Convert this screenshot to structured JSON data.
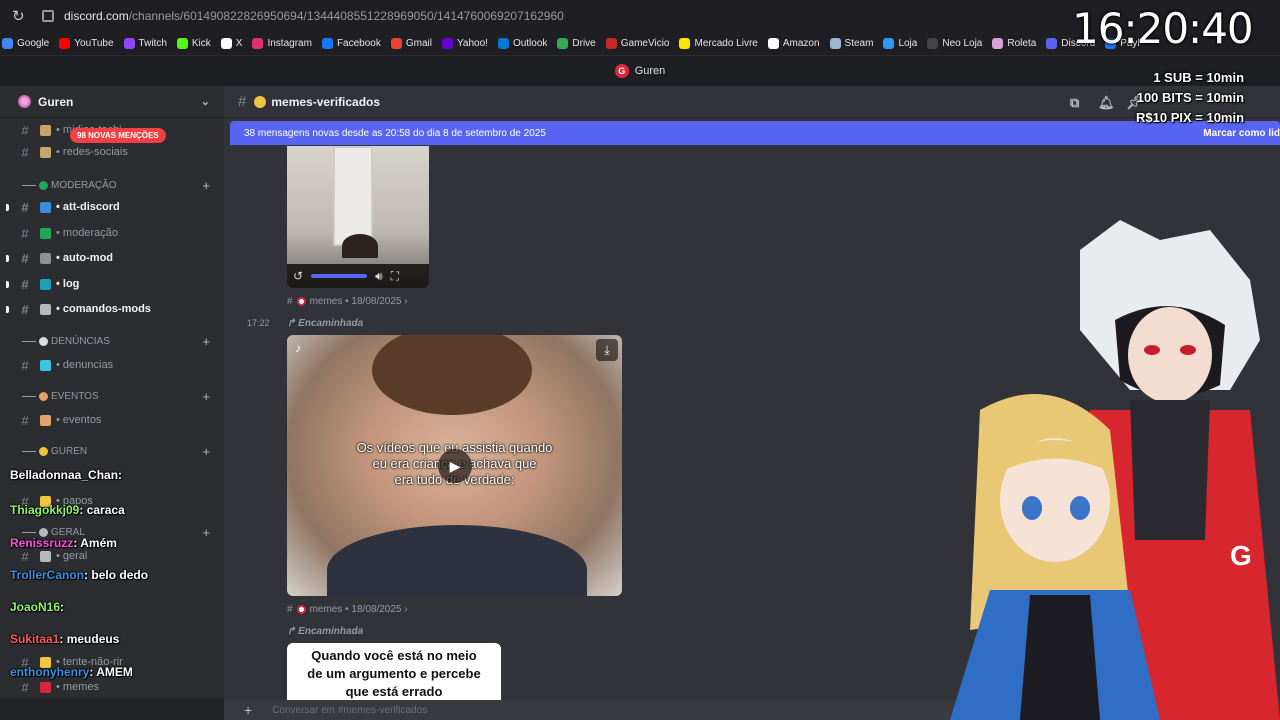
{
  "browser": {
    "url_main": "discord.com",
    "url_path": "/channels/601490822826950694/1344408551228969050/1414760069207162960",
    "bookmarks": [
      {
        "label": "Google",
        "color": "#4285f4"
      },
      {
        "label": "YouTube",
        "color": "#ff0000"
      },
      {
        "label": "Twitch",
        "color": "#9146ff"
      },
      {
        "label": "Kick",
        "color": "#53fc18"
      },
      {
        "label": "X",
        "color": "#ffffff"
      },
      {
        "label": "Instagram",
        "color": "#e1306c"
      },
      {
        "label": "Facebook",
        "color": "#1877f2"
      },
      {
        "label": "Gmail",
        "color": "#ea4335"
      },
      {
        "label": "Yahoo!",
        "color": "#6001d2"
      },
      {
        "label": "Outlook",
        "color": "#0078d4"
      },
      {
        "label": "Drive",
        "color": "#34a853"
      },
      {
        "label": "GameVicio",
        "color": "#c62828"
      },
      {
        "label": "Mercado Livre",
        "color": "#ffe600"
      },
      {
        "label": "Amazon",
        "color": "#ffffff"
      },
      {
        "label": "Steam",
        "color": "#9bb8d3"
      },
      {
        "label": "Loja",
        "color": "#2b9af3"
      },
      {
        "label": "Neo Loja",
        "color": "#444444"
      },
      {
        "label": "Roleta",
        "color": "#d6a0d9"
      },
      {
        "label": "Discord",
        "color": "#5865f2"
      },
      {
        "label": "Payl",
        "color": "#1877f2"
      }
    ]
  },
  "app_title": "Guren",
  "server": {
    "name": "Guren",
    "mention_pill": "98 NOVAS MENÇÕES"
  },
  "sidebar": {
    "channels": [
      {
        "label": "midias-tochi",
        "type": "ch",
        "unread": false,
        "emoji_color": "#c7a56a"
      },
      {
        "label": "redes-sociais",
        "type": "ch",
        "unread": false,
        "emoji_color": "#c7a56a"
      },
      {
        "label": "MODERAÇÃO",
        "type": "cat",
        "emoji_color": "#23a55a"
      },
      {
        "label": "att-discord",
        "type": "ch",
        "unread": true,
        "emoji_color": "#3b8ede"
      },
      {
        "label": "moderação",
        "type": "ch",
        "unread": false,
        "emoji_color": "#23a55a"
      },
      {
        "label": "auto-mod",
        "type": "ch",
        "unread": true,
        "emoji_color": "#8e9297"
      },
      {
        "label": "log",
        "type": "ch",
        "unread": true,
        "emoji_color": "#1a9fb5"
      },
      {
        "label": "comandos-mods",
        "type": "ch",
        "unread": true,
        "emoji_color": "#b5bac1"
      },
      {
        "label": "DENÚNCIAS",
        "type": "cat",
        "emoji_color": "#dcdcdc"
      },
      {
        "label": "denuncias",
        "type": "ch",
        "unread": false,
        "emoji_color": "#3fc4e0"
      },
      {
        "label": "EVENTOS",
        "type": "cat",
        "emoji_color": "#e0a36c"
      },
      {
        "label": "eventos",
        "type": "ch",
        "unread": false,
        "emoji_color": "#e0a36c"
      },
      {
        "label": "GUREN",
        "type": "cat",
        "emoji_color": "#f0c541"
      },
      {
        "label": "papos",
        "type": "ch",
        "unread": false,
        "emoji_color": "#f0c541"
      },
      {
        "label": "GERAL",
        "type": "cat",
        "emoji_color": "#b5bac1"
      },
      {
        "label": "geral",
        "type": "ch",
        "unread": false,
        "emoji_color": "#b5bac1"
      },
      {
        "label": "tente-não-rir",
        "type": "ch",
        "unread": false,
        "emoji_color": "#f0c541"
      },
      {
        "label": "memes",
        "type": "ch",
        "unread": false,
        "emoji_color": "#d7263d"
      }
    ]
  },
  "channel_header": {
    "name": "memes-verificados"
  },
  "main": {
    "new_messages": "38 mensagens novas desde as 20:58 do dia 8 de setembro de 2025",
    "mark_read": "Marcar como lid",
    "meta_source": "memes",
    "meta_date": "18/08/2025",
    "forwarded": "Encaminhada",
    "timestamp": "17:22",
    "video_caption_l1": "Os vídeos que eu assistia quando",
    "video_caption_l2": "eu era criança e achava que",
    "video_caption_l3": "era tudo de verdade:",
    "meme_text_l1": "Quando você está no meio",
    "meme_text_l2": "de um argumento e percebe",
    "meme_text_l3": "que está errado",
    "composer_placeholder": "Conversar em #memes-verificados"
  },
  "overlay": {
    "clock": "16:20:40",
    "donate_l1": "1 SUB = 10min",
    "donate_l2": "100 BITS = 10min",
    "donate_l3": "R$10 PIX = 10min",
    "chat": [
      {
        "user": "Belladonnaa_Chan",
        "msg": "",
        "color": "#ffffff"
      },
      {
        "user": "Thiagokkj09",
        "msg": "caraca",
        "color": "#8bf56a"
      },
      {
        "user": "Renissruzz",
        "msg": "Amém",
        "color": "#ff4de1"
      },
      {
        "user": "TrollerCanon",
        "msg": "belo dedo",
        "color": "#3b8ede"
      },
      {
        "user": "JoaoN16",
        "msg": "",
        "color": "#8bf56a"
      },
      {
        "user": "Sukitaa1",
        "msg": "meudeus",
        "color": "#ff5a5a"
      },
      {
        "user": "enthonyhenry",
        "msg": "AMEM",
        "color": "#3b8ede"
      }
    ]
  }
}
